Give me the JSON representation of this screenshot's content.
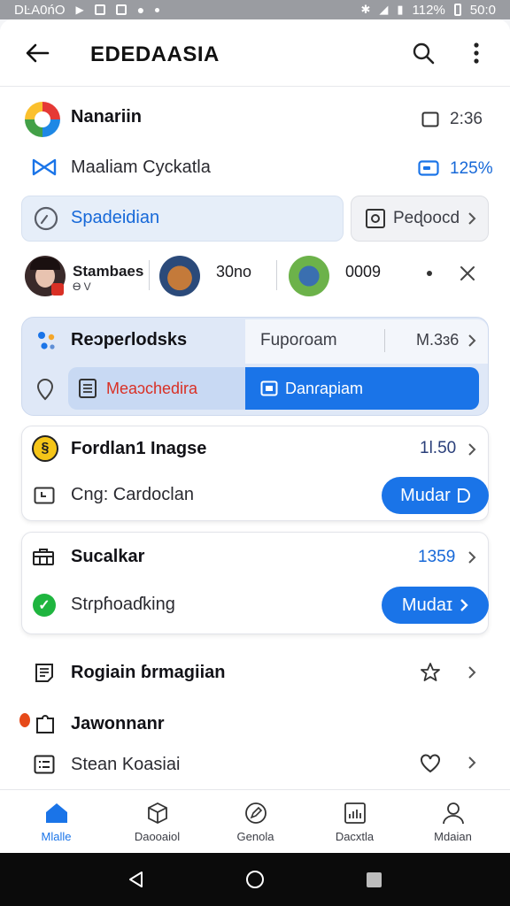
{
  "status_bar": {
    "time_left": "DĿA0ńO",
    "battery": "112%",
    "time_right": "50:0"
  },
  "app_bar": {
    "title": "EDEDAASIA"
  },
  "row1": {
    "label": "Nanariin",
    "value": "2:36"
  },
  "row2": {
    "label": "Maaliam Cyckatla",
    "value": "125%"
  },
  "row3": {
    "left_label": "Spadeidian",
    "right_label": "Peɖoocd"
  },
  "people": {
    "name1": "Stambaes",
    "sub1": "Ɵ V",
    "num2": "30no",
    "num3": "0009"
  },
  "tabs": {
    "top_left": "Reɔpeɾlodsks",
    "top_right": "Fupoɾoam",
    "top_value": "M.3ɜ6",
    "bottom_left": "Meaɔchedira",
    "bottom_right": "Danɾapiam"
  },
  "section1": {
    "title": "Fordlan1 Inagse",
    "value": "1l.50",
    "sub": "Cng: Cardoclan",
    "button": "Mudar"
  },
  "section2": {
    "title": "Sucalkar",
    "value": "1359",
    "sub": "Stɾpɦoaɗking",
    "button": "Mudaɪ"
  },
  "list": [
    {
      "label": "Rogiain ɓrmagiian"
    },
    {
      "label": "Jawonnanr"
    },
    {
      "label": "Stean Koasiai"
    }
  ],
  "bottom_nav": [
    {
      "label": "Mlalle"
    },
    {
      "label": "Daooaiol"
    },
    {
      "label": "Genola"
    },
    {
      "label": "Dacxtla"
    },
    {
      "label": "Mdaian"
    }
  ],
  "colors": {
    "accent": "#1a74e8",
    "red_text": "#d93025"
  }
}
